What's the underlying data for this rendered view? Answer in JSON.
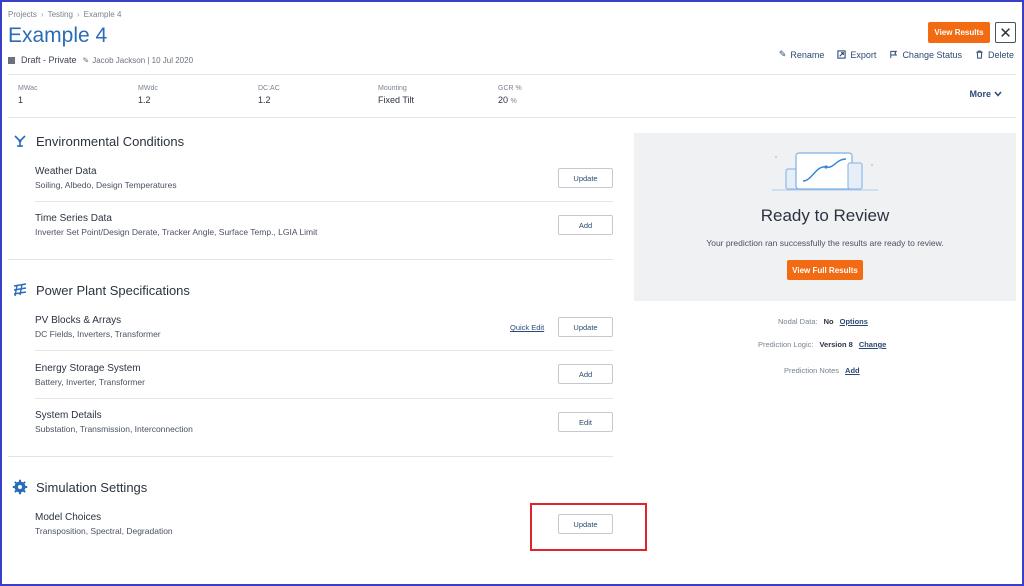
{
  "breadcrumb": {
    "items": [
      "Projects",
      "Testing",
      "Example 4"
    ]
  },
  "page": {
    "title": "Example 4",
    "status": "Draft - Private",
    "author_date": "Jacob Jackson | 10 Jul 2020"
  },
  "header": {
    "view_results_label": "View Results",
    "close_symbol": "✕",
    "actions": {
      "rename": "Rename",
      "export": "Export",
      "change_status": "Change Status",
      "delete": "Delete"
    }
  },
  "stats": [
    {
      "label": "MWac",
      "value": "1",
      "unit": ""
    },
    {
      "label": "MWdc",
      "value": "1.2",
      "unit": ""
    },
    {
      "label": "DC:AC",
      "value": "1.2",
      "unit": ""
    },
    {
      "label": "Mounting",
      "value": "Fixed Tilt",
      "unit": ""
    },
    {
      "label": "GCR %",
      "value": "20",
      "unit": "%"
    }
  ],
  "more_label": "More",
  "sections": {
    "environmental": {
      "title": "Environmental Conditions",
      "items": [
        {
          "title": "Weather Data",
          "subtitle": "Soiling, Albedo, Design Temperatures",
          "button": "Update"
        },
        {
          "title": "Time Series Data",
          "subtitle": "Inverter Set Point/Design Derate, Tracker Angle, Surface Temp., LGIA Limit",
          "button": "Add"
        }
      ]
    },
    "power_plant": {
      "title": "Power Plant Specifications",
      "items": [
        {
          "title": "PV Blocks & Arrays",
          "subtitle": "DC Fields, Inverters, Transformer",
          "button": "Update",
          "quick_edit": "Quick Edit"
        },
        {
          "title": "Energy Storage System",
          "subtitle": "Battery, Inverter, Transformer",
          "button": "Add"
        },
        {
          "title": "System Details",
          "subtitle": "Substation, Transmission, Interconnection",
          "button": "Edit"
        }
      ]
    },
    "simulation": {
      "title": "Simulation Settings",
      "items": [
        {
          "title": "Model Choices",
          "subtitle": "Transposition, Spectral, Degradation",
          "button": "Update"
        }
      ]
    }
  },
  "review": {
    "title": "Ready to Review",
    "subtitle": "Your prediction ran successfully the results are ready to review.",
    "button": "View Full Results"
  },
  "details": {
    "nodal": {
      "label": "Nodal Data:",
      "value": "No",
      "link": "Options"
    },
    "logic": {
      "label": "Prediction Logic:",
      "value": "Version 8",
      "link": "Change"
    },
    "notes": {
      "label": "Prediction Notes",
      "link": "Add"
    }
  },
  "colors": {
    "accent": "#f26a12",
    "title_blue": "#2b6cb8",
    "link_navy": "#2d4a72",
    "highlight_red": "#e0242a",
    "frame": "#3a3fc8"
  }
}
